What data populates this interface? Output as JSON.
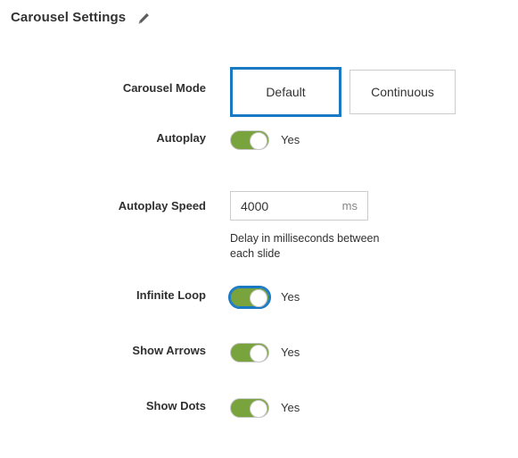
{
  "header": {
    "title": "Carousel Settings",
    "edit_icon": "pencil-icon"
  },
  "form": {
    "carousel_mode": {
      "label": "Carousel Mode",
      "options": [
        "Default",
        "Continuous"
      ],
      "selected": "Default",
      "selected_border_color": "#1979c3"
    },
    "autoplay": {
      "label": "Autoplay",
      "value": "Yes",
      "state": "on",
      "toggle_color": "#79a33d"
    },
    "autoplay_speed": {
      "label": "Autoplay Speed",
      "value": "4000",
      "placeholder": "4000",
      "suffix": "ms",
      "note": "Delay in milliseconds between each slide"
    },
    "infinite_loop": {
      "label": "Infinite Loop",
      "value": "Yes",
      "state": "on",
      "focused": true,
      "toggle_color": "#79a33d",
      "focus_ring_color": "#1979c3"
    },
    "show_arrows": {
      "label": "Show Arrows",
      "value": "Yes",
      "state": "on",
      "toggle_color": "#79a33d"
    },
    "show_dots": {
      "label": "Show Dots",
      "value": "Yes",
      "state": "on",
      "toggle_color": "#79a33d"
    }
  }
}
